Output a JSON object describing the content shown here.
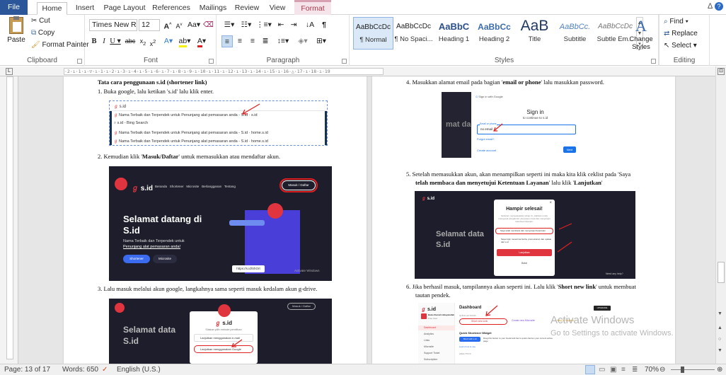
{
  "tabs": {
    "file": "File",
    "home": "Home",
    "insert": "Insert",
    "page_layout": "Page Layout",
    "references": "References",
    "mailings": "Mailings",
    "review": "Review",
    "view": "View",
    "format": "Format"
  },
  "ribbon": {
    "clipboard": {
      "paste": "Paste",
      "cut": "Cut",
      "copy": "Copy",
      "format_painter": "Format Painter",
      "label": "Clipboard"
    },
    "font": {
      "name": "Times New Rom",
      "size": "12",
      "label": "Font"
    },
    "paragraph": {
      "label": "Paragraph"
    },
    "styles": {
      "label": "Styles",
      "tiles": [
        {
          "preview": "AaBbCcDc",
          "name": "¶ Normal"
        },
        {
          "preview": "AaBbCcDc",
          "name": "¶ No Spaci..."
        },
        {
          "preview": "AaBbC",
          "name": "Heading 1"
        },
        {
          "preview": "AaBbCc",
          "name": "Heading 2"
        },
        {
          "preview": "AaB",
          "name": "Title"
        },
        {
          "preview": "AaBbCc.",
          "name": "Subtitle"
        },
        {
          "preview": "AaBbCcDc",
          "name": "Subtle Em..."
        }
      ],
      "change_styles": "Change Styles"
    },
    "editing": {
      "find": "Find",
      "replace": "Replace",
      "select": "Select",
      "label": "Editing"
    }
  },
  "ruler": {
    "horizontal": "·2·ı·1·ı·▽·ı·1·ı·2·ı·3·ı·4·ı·5·ı·6·ı·7·ı·8·ı·9·ı·10·ı·11·ı·12·ı·13·ı·14·ı·15·ı·16·△·17·ı·18·ı·19"
  },
  "doc_left": {
    "heading": "Tata cara penggunaan s.id (shortener link)",
    "step1": "1. Buka google, lalu ketikan 's.id' lalu klik enter.",
    "step2_pre": "2. Kemudian klik '",
    "step2_bold": "Masuk/Daftar",
    "step2_post": "' untuk memasukkan atau mendaftar akun.",
    "step3": "3. Lalu masuk melalui akun google, langkahnya sama seperti masuk kedalam akun g-drive.",
    "search_rows": [
      "s.id",
      "Nama Terbaik dan Terpendek untuk Penunjang alat pemasaran anda - S.id · s.id",
      "s.id - Bing Search",
      "Nama Terbaik dan Terpendek untuk Penunjang alat pemasaran anda - S.id · home.s.id",
      "Nama Terbaik dan Terpendek untuk Penunjang alat pemasaran anda - S.id · home.s.id"
    ],
    "sid_hero": {
      "brand": "s.id",
      "nav": [
        "Beranda",
        "Shortener",
        "Microsite",
        "Berlangganan",
        "Tentang"
      ],
      "login": "Masuk / Daftar",
      "title_1": "Selamat datang di",
      "title_2": "S.id",
      "subtitle_1": "Nama Terbaik dan Terpendek untuk",
      "subtitle_2": "Penunjang alat pemasaran anda!",
      "btn_shortener": "Shortener",
      "btn_microsite": "Microsite",
      "url": "https://s.id/ShOrt",
      "wm": "Activate Windows"
    },
    "sid_login": {
      "brand": "s.id",
      "sub": "Silakan pilih metode pemilihan",
      "option_email": "Lanjutkan menggunakan e-mail",
      "option_google": "Lanjutkan menggunakan Google",
      "bg_title_1": "Selamat data",
      "bg_title_2": "S.id",
      "login": "Masuk / Daftar"
    }
  },
  "doc_right": {
    "step4_pre": "4. Masukkan alamat email pada bagian '",
    "step4_bold": "email or phone",
    "step4_post": "' lalu masukkan password.",
    "step5_line1": "5. Setelah memasukkan akun, akan menampilkan seperti ini maka kita klik ceklist pada 'Saya",
    "step5_line2_bold": "telah membaca dan menyetujui Ketentuan Layanan",
    "step5_line2_mid": "' lalu klik '",
    "step5_line2_bold2": "Lanjutkan",
    "step5_line2_end": "'",
    "step6_line1_pre": "6. Jika berhasil masuk, tampilannya akan seperti ini. Lalu klik '",
    "step6_line1_bold": "Short new link",
    "step6_line1_post": "' untuk membuat",
    "step6_line2": "tautan pendek.",
    "google": {
      "header": "Sign in with Google",
      "title": "Sign in",
      "sub": "to continue to s.id",
      "field_label": "Email or phone",
      "field_value": "no email",
      "forgot": "Forgot email?",
      "create": "Create account",
      "next": "Next",
      "bg": "mat da"
    },
    "consent": {
      "title": "Hampir selesai!",
      "text": "Sebelum menyelesaikan tahap ini, silahkan untuk mengecek pengaturan yang kamu buat dan menyetujui ketentuan layanan.",
      "check1": "Saya telah membaca dan menyetujui Ketentuan",
      "check2": "Saya ingin menerima berita, promosional, dan update dari s.id",
      "continue": "Lanjutkan",
      "cancel": "Batal",
      "bg_1": "Selamat data",
      "bg_2": "S.id",
      "help": "Need any help?"
    },
    "dashboard": {
      "brand": "s.id",
      "title": "Dashboard",
      "user_name": "Buku Rumah Hidayatullah",
      "user_plan": "Free User",
      "quick_actions": "QUICK ACTIONS",
      "short_new_link": "Short new Link",
      "create_microsite": "Create new Microsite",
      "help_support": "Help & Support",
      "upgrade": "UPGRADE",
      "menu": [
        "Dashboard",
        "Analytics",
        "Links",
        "Microsite",
        "Support Ticket",
        "Subscription"
      ],
      "widget_title": "Quick Shortener Widget",
      "widget_btn": "Short with s.id",
      "widget_text": "Drag this button to your bookmark bar to quick shorten your current active page",
      "widget_link": "Learn how to use",
      "analytics": "ANALYTICS"
    }
  },
  "watermark": {
    "line1": "Activate Windows",
    "line2": "Go to Settings to activate Windows."
  },
  "status": {
    "page": "Page: 13 of 17",
    "words": "Words: 650",
    "language": "English (U.S.)",
    "zoom": "70%"
  }
}
